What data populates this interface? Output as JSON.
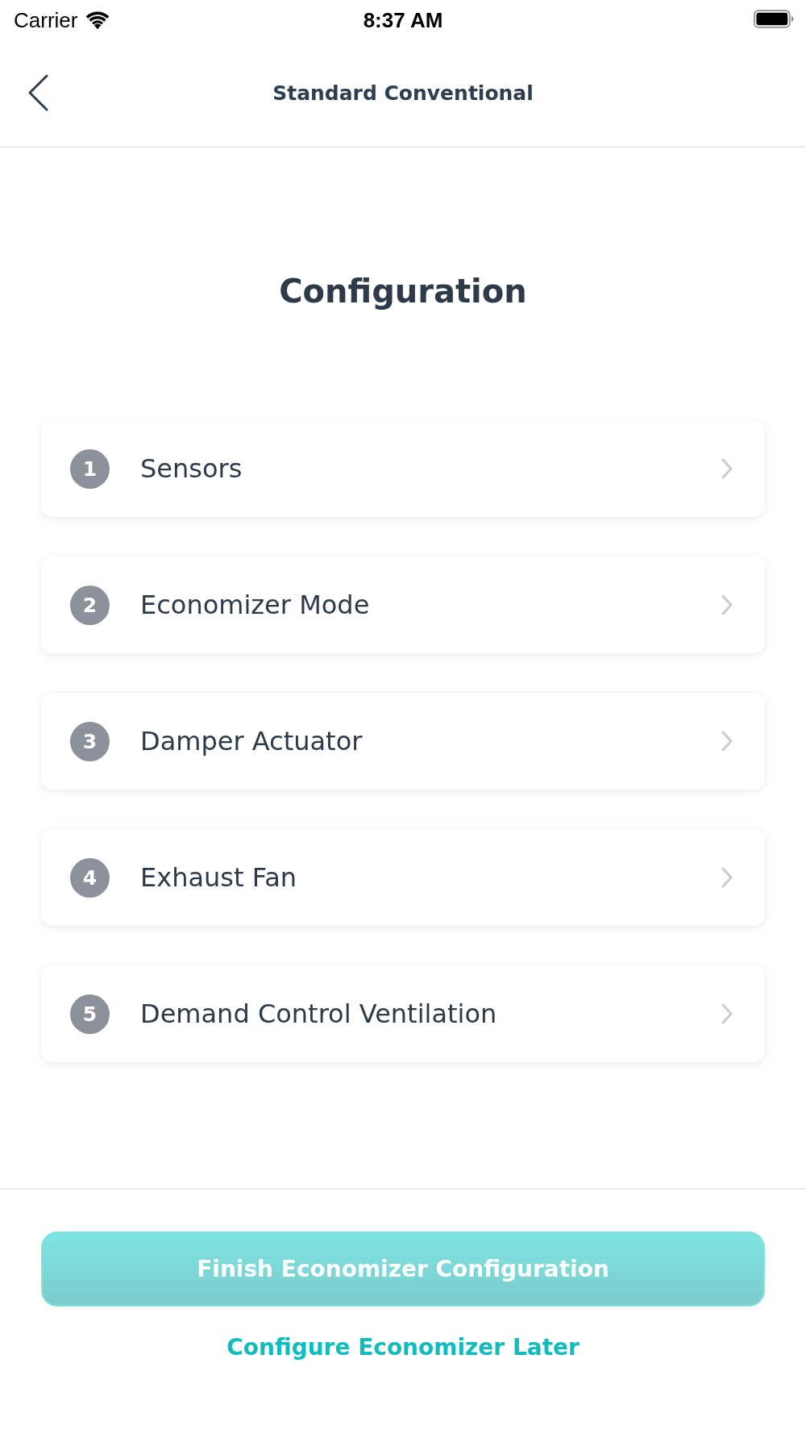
{
  "status_bar": {
    "carrier": "Carrier",
    "time": "8:37 AM"
  },
  "nav_bar": {
    "title": "Standard Conventional"
  },
  "heading": "Configuration",
  "steps": [
    {
      "number": "1",
      "label": "Sensors"
    },
    {
      "number": "2",
      "label": "Economizer Mode"
    },
    {
      "number": "3",
      "label": "Damper Actuator"
    },
    {
      "number": "4",
      "label": "Exhaust Fan"
    },
    {
      "number": "5",
      "label": "Demand Control Ventilation"
    }
  ],
  "footer": {
    "primary_button": {
      "label": "Finish Economizer Configuration",
      "disabled": true
    },
    "secondary_link": "Configure Economizer Later"
  }
}
